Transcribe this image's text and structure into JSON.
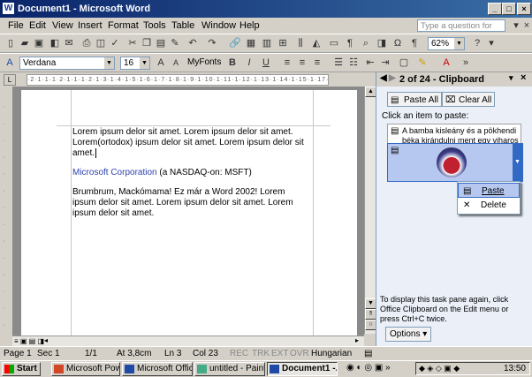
{
  "window": {
    "title": "Document1 - Microsoft Word"
  },
  "menu": [
    "File",
    "Edit",
    "View",
    "Insert",
    "Format",
    "Tools",
    "Table",
    "Window",
    "Help"
  ],
  "help_placeholder": "Type a question for help",
  "toolbar": {
    "zoom": "62%",
    "style": "Verdana",
    "size": "16",
    "myfonts": "MyFonts",
    "bold": "B",
    "italic": "I",
    "underline": "U"
  },
  "ruler": "·2·1·1·1·2·1·1·1·2·1·3·1·4·1·5·1·6·1·7·1·8·1·9·1·10·1·11·1·12·1·13·1·14·1·15·1·17·18",
  "document": {
    "p1": "Lorem ipsum delor sit amet. Lorem ipsum delor sit amet. Lorem(ortodox) ipsum delor sit amet. Lorem ipsum delor sit amet.",
    "p2_link": "Microsoft Corporation",
    "p2_rest": " (a NASDAQ-on: MSFT)",
    "p3": "Brumbrum, Mackómama! Ez már a Word 2002! Lorem ipsum delor sit amet. Lorem ipsum delor sit amet. Lorem ipsum delor sit amet."
  },
  "taskpane": {
    "title": "2 of 24 - Clipboard",
    "paste_all": "Paste All",
    "clear_all": "Clear All",
    "instruction": "Click an item to paste:",
    "item1": "A bamba kisleány és a pökhendi béka kirándulni ment egy viharos délután. Sárosan, kócosan érk...",
    "footer": "To display this task pane again, click Office Clipboard on the Edit menu or press Ctrl+C twice.",
    "options": "Options"
  },
  "context_menu": {
    "paste": "Paste",
    "delete": "Delete"
  },
  "status": {
    "page": "Page 1",
    "sec": "Sec 1",
    "pages": "1/1",
    "at": "At 3,8cm",
    "ln": "Ln 3",
    "col": "Col 23",
    "rec": "REC",
    "trk": "TRK",
    "ext": "EXT",
    "ovr": "OVR",
    "lang": "Hungarian"
  },
  "taskbar": {
    "start": "Start",
    "tasks": [
      "Microsoft Pow...",
      "Microsoft Offic...",
      "untitled - Paint",
      "Document1 -..."
    ],
    "clock": "13:50"
  },
  "colors": {
    "title_bar": "#0a246a",
    "link": "#2b3fae",
    "taskpane_bg": "#eaeff8",
    "selected": "#b6c8f0"
  }
}
